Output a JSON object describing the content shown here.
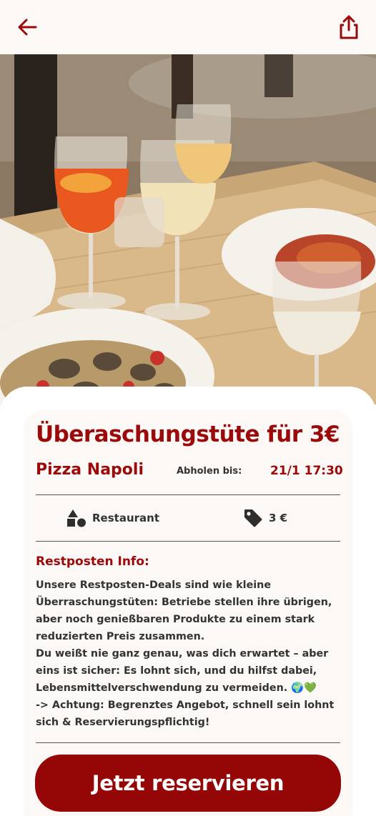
{
  "header": {
    "back_icon": "arrow-left-icon",
    "share_icon": "share-icon",
    "accent_color": "#9b0a0a"
  },
  "hero": {
    "image_subject": "restaurant-table-photo"
  },
  "offer": {
    "title": "Überaschungstüte für 3€",
    "store_name": "Pizza Napoli",
    "pickup_label": "Abholen bis:",
    "pickup_time": "21/1 17:30"
  },
  "meta": {
    "category_icon": "shapes-icon",
    "category_label": "Restaurant",
    "price_icon": "price-tag-icon",
    "price_label": "3 €"
  },
  "info": {
    "heading": "Restposten Info:",
    "lines": [
      "Unsere Restposten-Deals sind wie kleine",
      "Überraschungstüten: Betriebe stellen ihre übrigen,",
      "aber noch genießbaren Produkte zu einem stark",
      "reduzierten Preis zusammen.",
      "Du weißt nie ganz genau, was dich erwartet – aber",
      "eins ist sicher: Es lohnt sich, und du hilfst dabei,",
      "Lebensmittelverschwendung zu vermeiden. 🌍💚",
      "-> Achtung: Begrenztes Angebot, schnell sein lohnt",
      "sich & Reservierungspflichtig!"
    ]
  },
  "actions": {
    "reserve_label": "Jetzt reservieren",
    "button_color": "#950707"
  }
}
